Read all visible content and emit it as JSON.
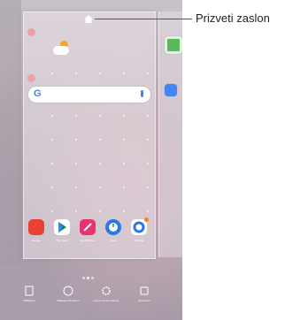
{
  "callout": {
    "label": "Prizveti zaslon"
  },
  "dock": {
    "apps": [
      {
        "label": "Google",
        "color": "#e94235"
      },
      {
        "label": "Play Store",
        "color": "#ffffff"
      },
      {
        "label": "QuickMemo+",
        "color": "#e8336f"
      },
      {
        "label": "Clock",
        "color": "#2b78e4"
      },
      {
        "label": "Settings",
        "color": "#ffffff"
      }
    ]
  },
  "bottom_actions": [
    {
      "icon": "wallpaper-icon",
      "label": "Wallpaper"
    },
    {
      "icon": "palette-icon",
      "label": "Wallpaper & theme"
    },
    {
      "icon": "gear-icon",
      "label": "Home screen settings"
    },
    {
      "icon": "apps-icon",
      "label": "App icons"
    }
  ],
  "search": {
    "logo": "G"
  },
  "colors": {
    "accent_red": "#e8505b",
    "google_blue": "#4285f4"
  }
}
